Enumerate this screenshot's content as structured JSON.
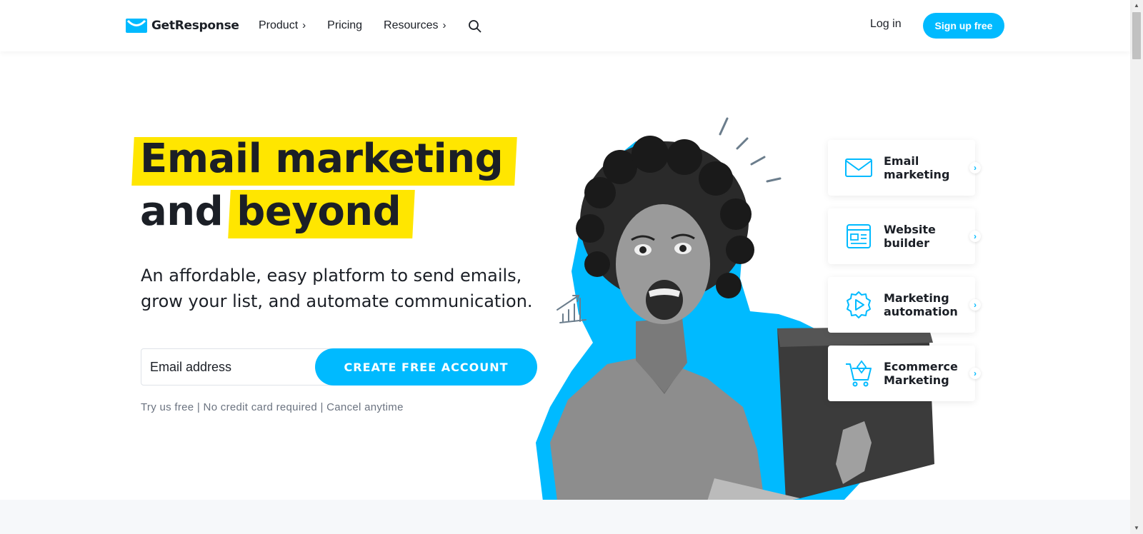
{
  "header": {
    "brand": "GetResponse",
    "nav": [
      {
        "label": "Product",
        "chevron": "›"
      },
      {
        "label": "Pricing",
        "chevron": ""
      },
      {
        "label": "Resources",
        "chevron": "›"
      }
    ],
    "login": "Log in",
    "signup": "Sign up free"
  },
  "hero": {
    "headline_1": "Email marketing",
    "headline_2a": "and",
    "headline_2b": "beyond",
    "subtitle": "An affordable, easy platform to send emails, grow your list, and automate communication.",
    "email_placeholder": "Email address",
    "cta": "CREATE FREE ACCOUNT",
    "note": "Try us free | No credit card required | Cancel anytime"
  },
  "features": [
    {
      "label": "Email\nmarketing",
      "icon": "envelope-icon"
    },
    {
      "label": "Website\nbuilder",
      "icon": "website-icon"
    },
    {
      "label": "Marketing\nautomation",
      "icon": "gear-play-icon"
    },
    {
      "label": "Ecommerce\nMarketing",
      "icon": "cart-icon"
    }
  ],
  "colors": {
    "accent": "#00baff",
    "highlight": "#ffe600",
    "text": "#1b1f26"
  }
}
